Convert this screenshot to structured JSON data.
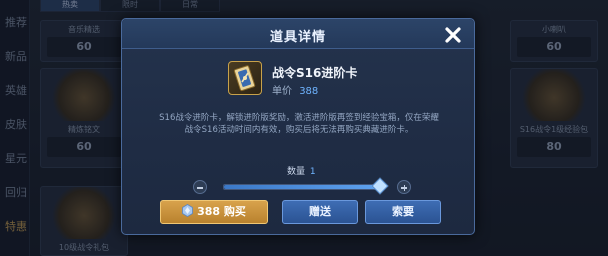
{
  "background": {
    "sidebar": [
      "推荐",
      "新品",
      "英雄",
      "皮肤",
      "星元",
      "回归",
      "特惠"
    ],
    "tabs": [
      "热卖",
      "限时",
      "日常"
    ],
    "cards": [
      {
        "name": "音乐精选",
        "price": "60"
      },
      {
        "name": "精炼铭文",
        "price": "60"
      },
      {
        "name": "小喇叭",
        "price": "60"
      },
      {
        "name": "S16战令1级经验包",
        "price": "80"
      },
      {
        "name": "10级战令礼包",
        "price": ""
      }
    ]
  },
  "dialog": {
    "title": "道具详情",
    "item": {
      "name": "战令S16进阶卡",
      "price_label": "单价",
      "price_value": "388",
      "icon": "battle-pass-card-icon"
    },
    "description": "S16战令进阶卡，解锁进阶版奖励，激活进阶版再签到经验宝箱，仅在荣耀战令S16活动时间内有效，购买后将无法再购买典藏进阶卡。",
    "quantity": {
      "label": "数量",
      "value": "1",
      "slider_fraction": 1.0
    },
    "buttons": {
      "buy": "388 购买",
      "gift": "赠送",
      "ask": "索要"
    },
    "colors": {
      "accent": "#6fb4ff",
      "buy": "#d8a24c",
      "secondary": "#3e6db4"
    }
  }
}
